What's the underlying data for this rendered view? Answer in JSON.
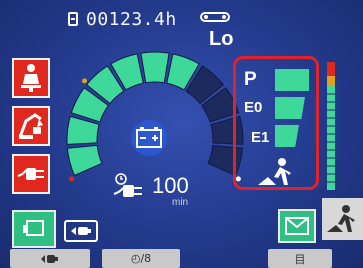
{
  "header": {
    "hour_meter_value": "00123.4h",
    "mode_text": "Lo"
  },
  "gauge": {
    "remaining_minutes": "100",
    "remaining_unit": "min",
    "segments_total": 11,
    "segments_lit": 7
  },
  "power_mode": {
    "modes": [
      {
        "label": "P"
      },
      {
        "label": "E0"
      },
      {
        "label": "E1"
      }
    ]
  },
  "softkeys": {
    "key_2": "◴/8",
    "key_3": "目"
  },
  "colors": {
    "alert_red": "#e0281e",
    "active_green": "#2fbf83",
    "bar_green": "#3ed89a",
    "panel_border_red": "#e0232b",
    "screen_blue": "#2a3d86"
  },
  "icons": {
    "left_column": [
      "operator-seat-icon",
      "excavator-lock-icon",
      "charging-plug-icon"
    ],
    "gauge_center": "battery-icon",
    "minutes_row": "timer-plug-icon",
    "bottom_right": [
      "mail-icon",
      "worker-icon"
    ]
  }
}
